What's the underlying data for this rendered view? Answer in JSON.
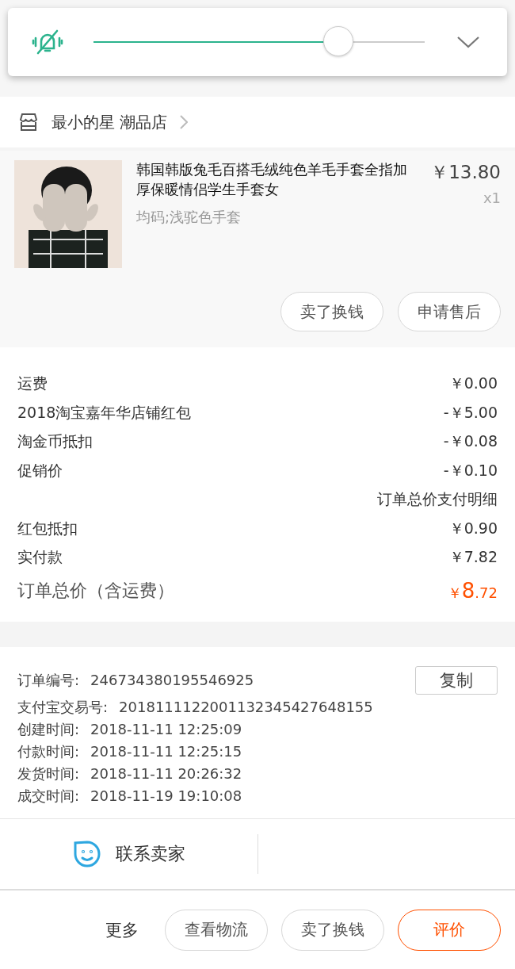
{
  "volume_panel": {
    "muted": true,
    "level": 0.74
  },
  "store": {
    "name": "最小的星 潮品店"
  },
  "product": {
    "title": "韩国韩版兔毛百搭毛绒纯色羊毛手套全指加厚保暖情侣学生手套女",
    "sku": "均码;浅驼色手套",
    "price": "￥13.80",
    "quantity": "x1",
    "buttons": [
      "卖了换钱",
      "申请售后"
    ]
  },
  "fees": [
    {
      "kind": "fee",
      "label": "运费",
      "value": "￥0.00"
    },
    {
      "kind": "fee",
      "label": "2018淘宝嘉年华店铺红包",
      "value": "-￥5.00"
    },
    {
      "kind": "fee",
      "label": "淘金币抵扣",
      "value": "-￥0.08"
    },
    {
      "kind": "fee",
      "label": "促销价",
      "value": "-￥0.10"
    },
    {
      "kind": "note",
      "value": "订单总价支付明细"
    },
    {
      "kind": "fee",
      "label": "红包抵扣",
      "value": "￥0.90"
    },
    {
      "kind": "fee",
      "label": "实付款",
      "value": "￥7.82"
    },
    {
      "kind": "total",
      "label": "订单总价（含运费）",
      "currency": "￥",
      "integer": "8",
      "decimal": ".72"
    }
  ],
  "order_info": [
    {
      "label": "订单编号:",
      "value": "246734380195546925",
      "action": "复制"
    },
    {
      "label": "支付宝交易号:",
      "value": "2018111122001132345427648155"
    },
    {
      "label": "创建时间:",
      "value": "2018-11-11 12:25:09"
    },
    {
      "label": "付款时间:",
      "value": "2018-11-11 12:25:15"
    },
    {
      "label": "发货时间:",
      "value": "2018-11-11 20:26:32"
    },
    {
      "label": "成交时间:",
      "value": "2018-11-19 19:10:08"
    }
  ],
  "contact": {
    "label": "联系卖家"
  },
  "bottom_bar": {
    "more": "更多",
    "buttons": [
      {
        "label": "查看物流",
        "primary": false
      },
      {
        "label": "卖了换钱",
        "primary": false
      },
      {
        "label": "评价",
        "primary": true
      }
    ]
  }
}
